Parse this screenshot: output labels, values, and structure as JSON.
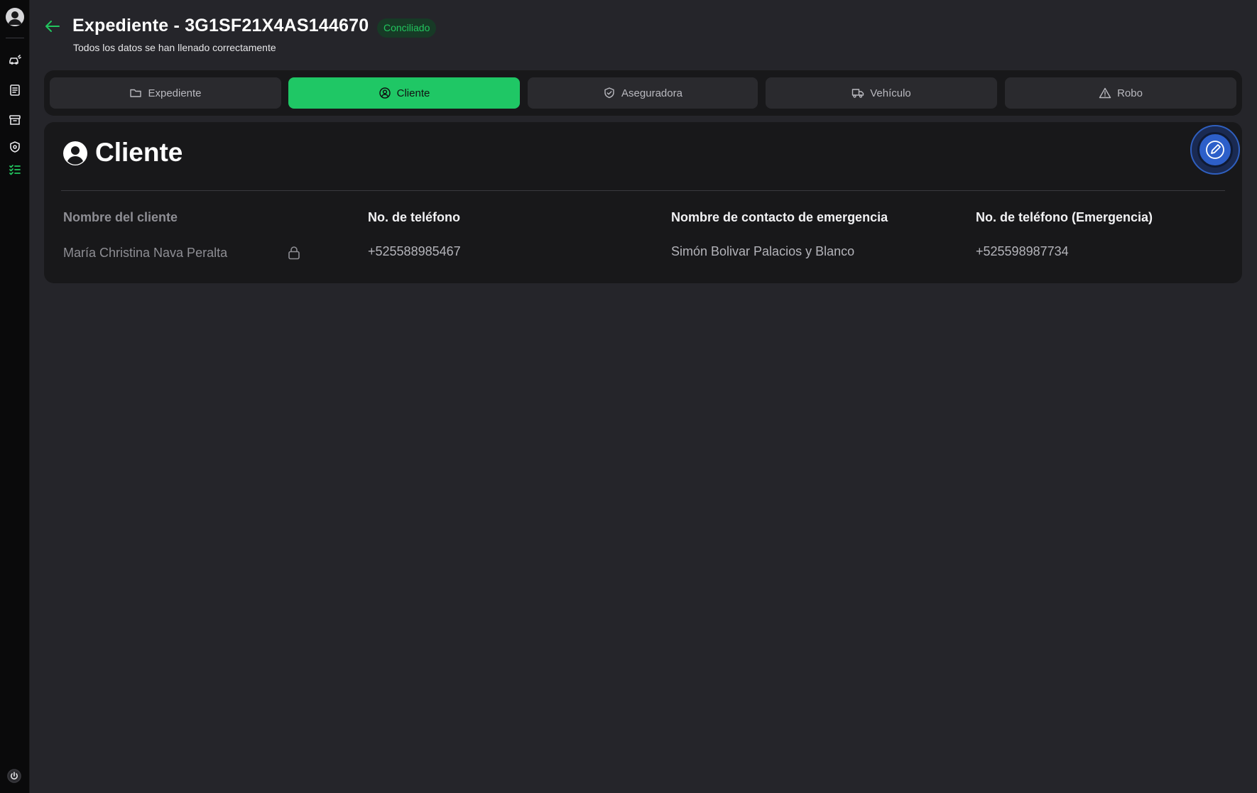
{
  "header": {
    "title": "Expediente - 3G1SF21X4AS144670",
    "status_badge": "Conciliado",
    "subtitle": "Todos los datos se han llenado correctamente"
  },
  "tabs": [
    {
      "label": "Expediente",
      "icon": "folder-icon",
      "active": false
    },
    {
      "label": "Cliente",
      "icon": "user-circle-icon",
      "active": true
    },
    {
      "label": "Aseguradora",
      "icon": "shield-check-icon",
      "active": false
    },
    {
      "label": "Vehículo",
      "icon": "truck-icon",
      "active": false
    },
    {
      "label": "Robo",
      "icon": "warning-triangle-icon",
      "active": false
    }
  ],
  "card": {
    "title": "Cliente",
    "fields": [
      {
        "label": "Nombre del cliente",
        "value": "María Christina Nava Peralta",
        "locked": true
      },
      {
        "label": "No. de teléfono",
        "value": "+525588985467",
        "locked": false
      },
      {
        "label": "Nombre de contacto de emergencia",
        "value": "Simón Bolivar Palacios y Blanco",
        "locked": false
      },
      {
        "label": "No. de teléfono (Emergencia)",
        "value": "+525598987734",
        "locked": false
      }
    ]
  },
  "sidebar": {
    "icons": [
      "user-avatar-icon",
      "car-icon",
      "document-list-icon",
      "archive-icon",
      "shield-icon",
      "checklist-icon",
      "power-icon"
    ],
    "active": "checklist-icon"
  },
  "colors": {
    "accent": "#1fc765",
    "background": "#25252a",
    "panel": "#18181a",
    "edit_button": "#2d5fc9"
  }
}
